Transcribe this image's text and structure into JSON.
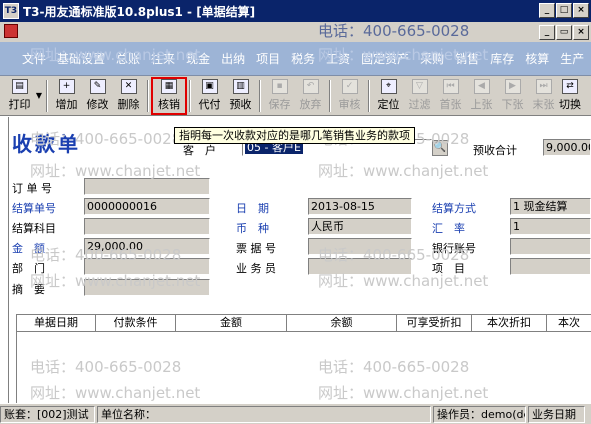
{
  "window": {
    "title": "T3-用友通标准版10.8plus1 - [单据结算]",
    "app_icon": "T3",
    "minimize": "_",
    "maximize": "□",
    "close": "×"
  },
  "mdi": {
    "minimize": "_",
    "restore": "▭",
    "close": "×"
  },
  "menu": [
    "文件",
    "基础设置",
    "总账",
    "往来",
    "现金",
    "出纳",
    "项目",
    "税务",
    "工资",
    "固定资产",
    "采购",
    "销售",
    "库存",
    "核算",
    "生产",
    "票据"
  ],
  "toolbar": {
    "print": "打印",
    "add": "增加",
    "modify": "修改",
    "delete": "删除",
    "writeoff": "核销",
    "agent": "代付",
    "prepay": "预收",
    "save": "保存",
    "discard": "放弃",
    "audit": "审核",
    "locate": "定位",
    "filter": "过滤",
    "first": "首张",
    "prev": "上张",
    "next": "下张",
    "last": "末张",
    "switch": "切换"
  },
  "tooltip": "指明每一次收款对应的是哪几笔销售业务的款项",
  "voucher": {
    "title": "收款单",
    "customer_label": "客　户",
    "customer_value": "05 - 客户E",
    "prepay_total_label": "预收合计",
    "prepay_total_value": "9,000.00"
  },
  "form": {
    "order_no_label": "订 单 号",
    "settle_no_label": "结算单号",
    "settle_no_value": "0000000016",
    "settle_subject_label": "结算科目",
    "amount_label": "金　额",
    "amount_value": "29,000.00",
    "dept_label": "部　门",
    "summary_label": "摘　要",
    "date_label": "日　期",
    "date_value": "2013-08-15",
    "currency_label": "币　种",
    "currency_value": "人民币",
    "bill_no_label": "票 据 号",
    "staff_label": "业 务 员",
    "settle_method_label": "结算方式",
    "settle_method_value": "1 现金结算",
    "rate_label": "汇　率",
    "rate_value": "1",
    "bank_account_label": "银行账号",
    "project_label": "项　目"
  },
  "grid": {
    "columns": [
      "单据日期",
      "付款条件",
      "金额",
      "余额",
      "可享受折扣",
      "本次折扣",
      "本次"
    ]
  },
  "status": {
    "account": "账套：[002]测试",
    "unit": "单位名称：",
    "operator": "操作员：demo(de",
    "bizdate": "业务日期"
  },
  "watermarks": [
    "电话：400-665-0028",
    "网址：www.chanjet.net"
  ],
  "colors": {
    "titlebar": "#0a246a",
    "menu_band": "#9db4d6",
    "voucher_title": "#1a3fb0",
    "highlight": "#e00000"
  }
}
